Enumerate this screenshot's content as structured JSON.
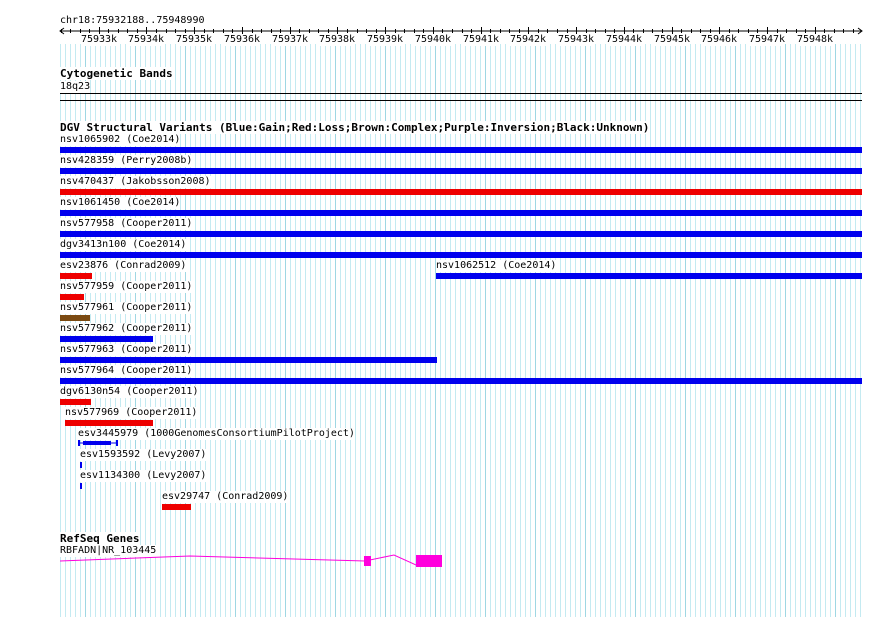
{
  "region": "chr18:75932188..75948990",
  "ruler": {
    "ticks": [
      "75933k",
      "75934k",
      "75935k",
      "75936k",
      "75937k",
      "75938k",
      "75939k",
      "75940k",
      "75941k",
      "75942k",
      "75943k",
      "75944k",
      "75945k",
      "75946k",
      "75947k",
      "75948k"
    ]
  },
  "cytoband": {
    "title": "Cytogenetic Bands",
    "band": "18q23"
  },
  "dgv": {
    "title": "DGV Structural Variants (Blue:Gain;Red:Loss;Brown:Complex;Purple:Inversion;Black:Unknown)",
    "colors": {
      "gain": "#0000ee",
      "loss": "#ee0000",
      "complex": "#7b4a12",
      "unknown": "#0000ee"
    },
    "features": [
      {
        "label": "nsv1065902 (Coe2014)",
        "type": "gain"
      },
      {
        "label": "nsv428359 (Perry2008b)",
        "type": "gain"
      },
      {
        "label": "nsv470437 (Jakobsson2008)",
        "type": "loss"
      },
      {
        "label": "nsv1061450 (Coe2014)",
        "type": "gain"
      },
      {
        "label": "nsv577958 (Cooper2011)",
        "type": "gain"
      },
      {
        "label": "dgv3413n100 (Coe2014)",
        "type": "gain"
      },
      {
        "label": "esv23876 (Conrad2009)",
        "type": "loss"
      },
      {
        "label": "nsv1062512 (Coe2014)",
        "type": "gain"
      },
      {
        "label": "nsv577959 (Cooper2011)",
        "type": "loss"
      },
      {
        "label": "nsv577961 (Cooper2011)",
        "type": "complex"
      },
      {
        "label": "nsv577962 (Cooper2011)",
        "type": "gain"
      },
      {
        "label": "nsv577963 (Cooper2011)",
        "type": "gain"
      },
      {
        "label": "nsv577964 (Cooper2011)",
        "type": "gain"
      },
      {
        "label": "dgv6130n54 (Cooper2011)",
        "type": "loss"
      },
      {
        "label": "nsv577969 (Cooper2011)",
        "type": "loss"
      },
      {
        "label": "esv3445979 (1000GenomesConsortiumPilotProject)",
        "type": "gain"
      },
      {
        "label": "esv1593592 (Levy2007)",
        "type": "gain"
      },
      {
        "label": "esv1134300 (Levy2007)",
        "type": "gain"
      },
      {
        "label": "esv29747 (Conrad2009)",
        "type": "loss"
      }
    ]
  },
  "refseq": {
    "title": "RefSeq Genes",
    "gene_label": "RBFADN|NR_103445",
    "color": "#ff00dd"
  }
}
